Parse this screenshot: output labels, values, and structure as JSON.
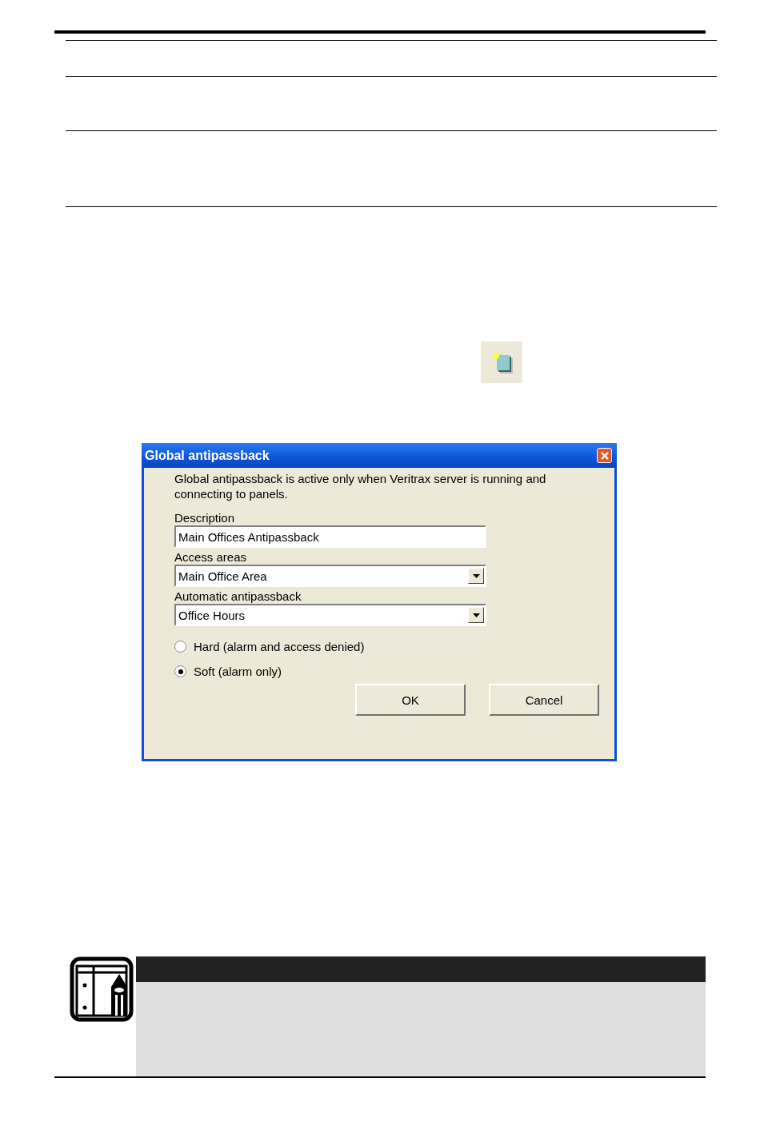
{
  "dialog": {
    "title": "Global antipassback",
    "message": "Global antipassback is active only when Veritrax server is running and connecting to panels.",
    "fields": [
      {
        "kind": "text",
        "label": "Description",
        "value": "Main Offices Antipassback"
      },
      {
        "kind": "dropdown",
        "label": "Access areas",
        "value": "Main Office Area"
      },
      {
        "kind": "dropdown",
        "label": "Automatic antipassback",
        "value": "Office Hours"
      }
    ],
    "options": [
      {
        "label": "Hard (alarm and access denied)",
        "selected": false
      },
      {
        "label": "Soft (alarm only)",
        "selected": true
      }
    ],
    "buttons": [
      "OK",
      "Cancel"
    ]
  }
}
